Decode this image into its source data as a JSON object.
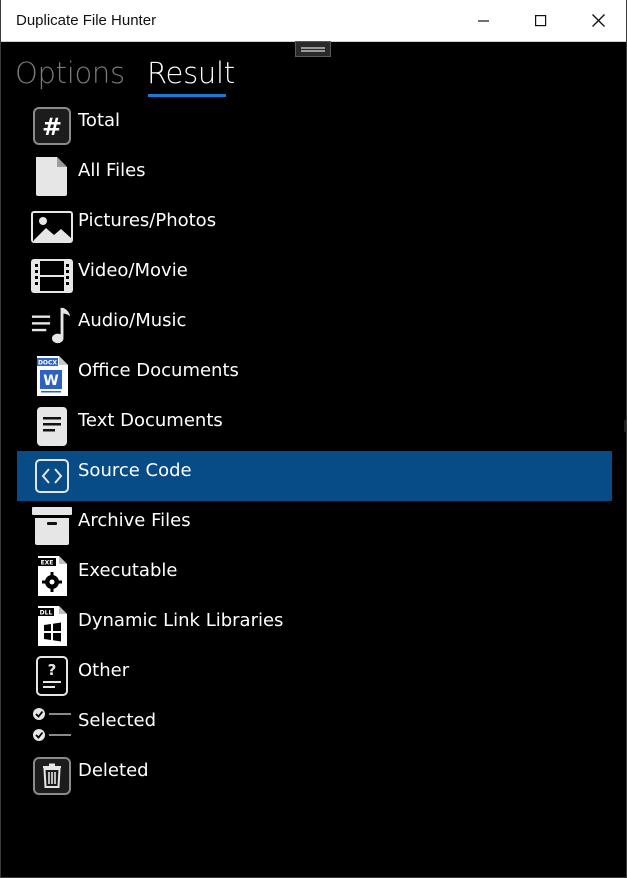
{
  "window": {
    "title": "Duplicate File Hunter"
  },
  "tabs": [
    {
      "label": "Options",
      "active": false
    },
    {
      "label": "Result",
      "active": true
    }
  ],
  "categories": [
    {
      "label": "Total",
      "icon": "hash-icon",
      "selected": false
    },
    {
      "label": "All Files",
      "icon": "file-icon",
      "selected": false
    },
    {
      "label": "Pictures/Photos",
      "icon": "picture-icon",
      "selected": false
    },
    {
      "label": "Video/Movie",
      "icon": "film-icon",
      "selected": false
    },
    {
      "label": "Audio/Music",
      "icon": "music-icon",
      "selected": false
    },
    {
      "label": "Office Documents",
      "icon": "word-document-icon",
      "selected": false
    },
    {
      "label": "Text Documents",
      "icon": "text-document-icon",
      "selected": false
    },
    {
      "label": "Source Code",
      "icon": "code-icon",
      "selected": true
    },
    {
      "label": "Archive Files",
      "icon": "archive-box-icon",
      "selected": false
    },
    {
      "label": "Executable",
      "icon": "executable-icon",
      "selected": false
    },
    {
      "label": "Dynamic Link Libraries",
      "icon": "dll-icon",
      "selected": false
    },
    {
      "label": "Other",
      "icon": "question-document-icon",
      "selected": false
    },
    {
      "label": "Selected",
      "icon": "checklist-icon",
      "selected": false
    },
    {
      "label": "Deleted",
      "icon": "trash-icon",
      "selected": false
    }
  ],
  "icon_text": {
    "docx": "DOCX",
    "word": "W",
    "exe": "EXE",
    "dll": "DLL",
    "hash": "#",
    "question": "?"
  },
  "colors": {
    "background": "#000000",
    "selected_row": "#074b87",
    "tab_underline": "#1f78d1",
    "inactive_tab": "#7a7a7a",
    "word_blue": "#2b62c4"
  }
}
